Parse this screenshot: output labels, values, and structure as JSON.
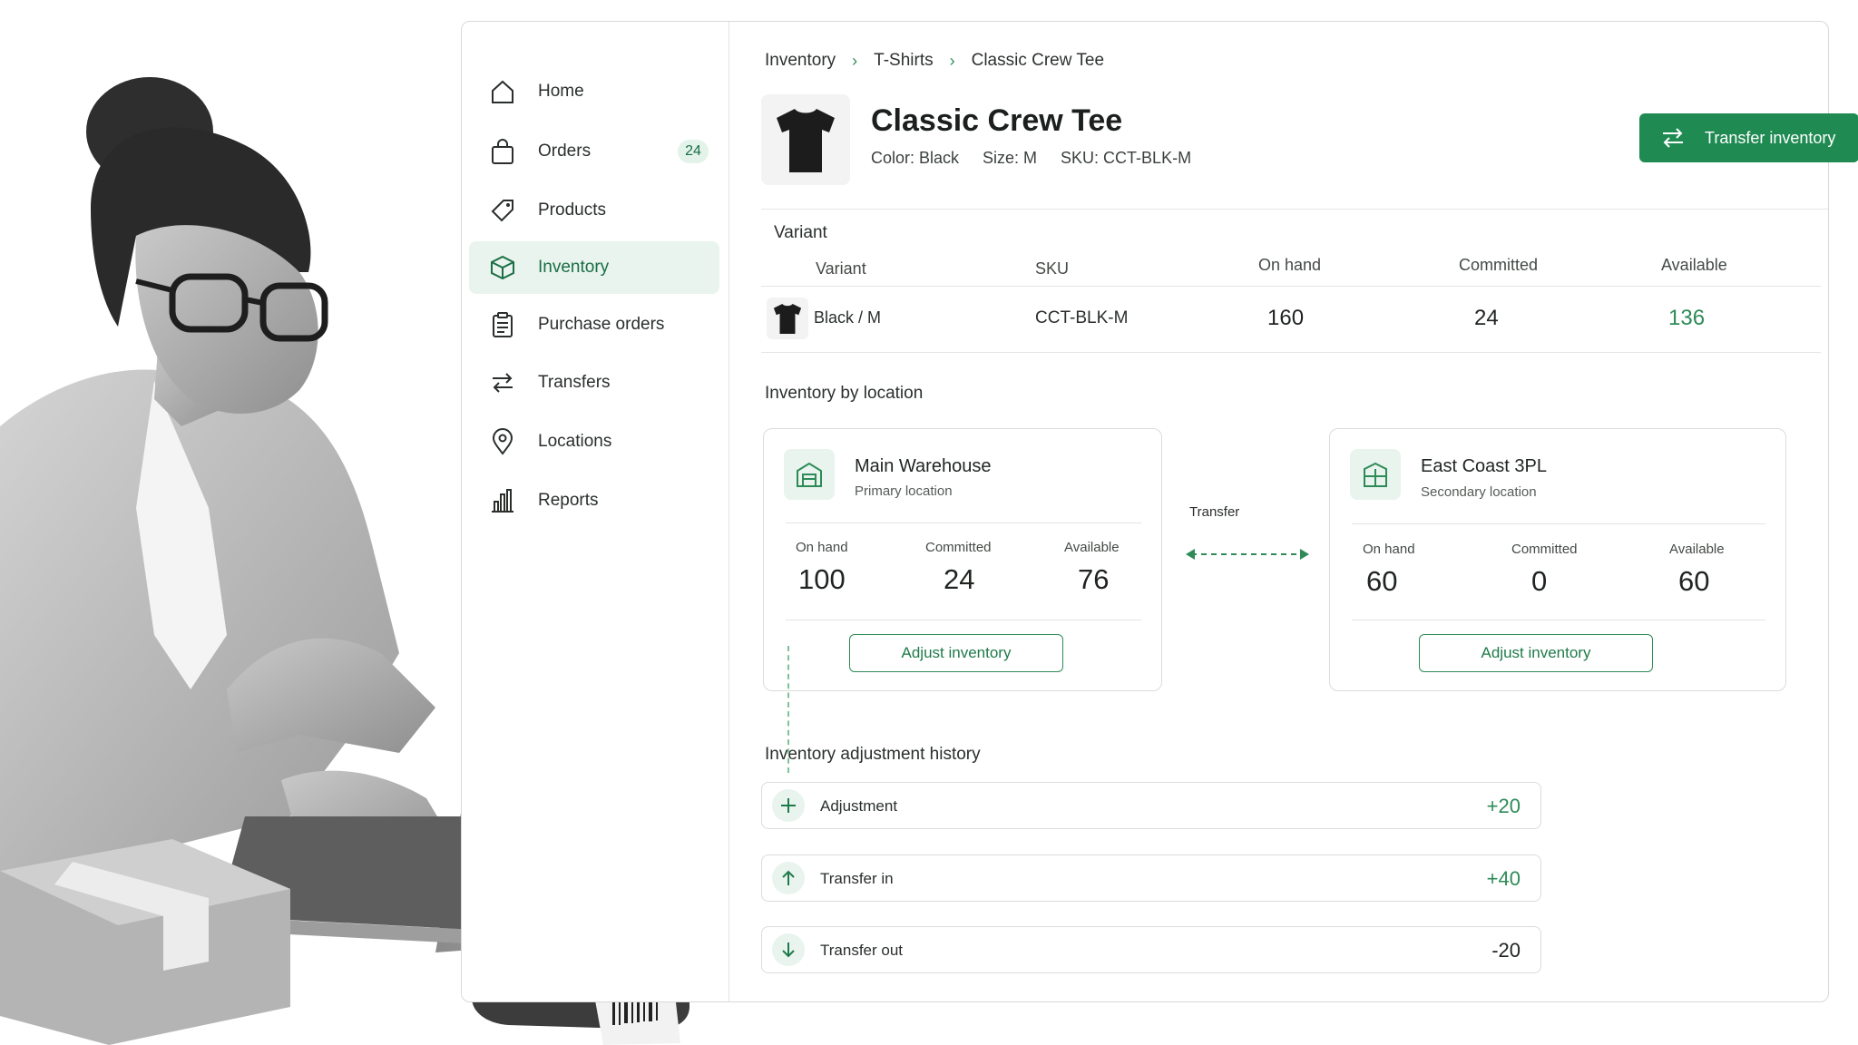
{
  "breadcrumb": [
    "Inventory",
    "T-Shirts",
    "Classic Crew Tee"
  ],
  "sidebar": {
    "items": [
      {
        "label": "Home",
        "icon": "home-icon"
      },
      {
        "label": "Orders",
        "icon": "shopping-bag-icon",
        "badge": "24"
      },
      {
        "label": "Products",
        "icon": "tag-icon"
      },
      {
        "label": "Inventory",
        "icon": "box-icon",
        "active": true
      },
      {
        "label": "Purchase orders",
        "icon": "clipboard-icon"
      },
      {
        "label": "Transfers",
        "icon": "arrows-swap-icon"
      },
      {
        "label": "Locations",
        "icon": "map-pin-icon"
      },
      {
        "label": "Reports",
        "icon": "bar-chart-icon"
      }
    ]
  },
  "product": {
    "title": "Classic Crew Tee",
    "color": "Color: Black",
    "size": "Size: M",
    "sku": "SKU: CCT-BLK-M",
    "thumbnail_icon": "tshirt-icon"
  },
  "actions": {
    "transfer_inventory": "Transfer inventory"
  },
  "variant_table": {
    "section_label": "Variant",
    "columns": [
      "Variant",
      "SKU",
      "On hand",
      "Committed",
      "Available"
    ],
    "rows": [
      {
        "variant": "Black / M",
        "sku": "CCT-BLK-M",
        "on_hand": "160",
        "committed": "24",
        "available": "136"
      }
    ]
  },
  "locations": {
    "section_label": "Inventory by location",
    "transfer_label": "Transfer",
    "cards": [
      {
        "name": "Main Warehouse",
        "subtitle": "Primary location",
        "icon": "warehouse-icon",
        "stats": {
          "on_hand_label": "On hand",
          "on_hand": "100",
          "committed_label": "Committed",
          "committed": "24",
          "available_label": "Available",
          "available": "76"
        },
        "button": "Adjust inventory"
      },
      {
        "name": "East Coast 3PL",
        "subtitle": "Secondary location",
        "icon": "building-icon",
        "stats": {
          "on_hand_label": "On hand",
          "on_hand": "60",
          "committed_label": "Committed",
          "committed": "0",
          "available_label": "Available",
          "available": "60"
        },
        "button": "Adjust inventory"
      }
    ]
  },
  "history": {
    "section_label": "Inventory adjustment history",
    "rows": [
      {
        "label": "Adjustment",
        "value": "+20",
        "icon": "plus-icon"
      },
      {
        "label": "Transfer in",
        "value": "+40",
        "icon": "arrow-up-icon"
      },
      {
        "label": "Transfer out",
        "value": "-20",
        "icon": "arrow-down-icon"
      }
    ]
  },
  "colors": {
    "accent": "#1f8a52",
    "accent_light": "#e8f4ed",
    "positive": "#2e8b57"
  }
}
